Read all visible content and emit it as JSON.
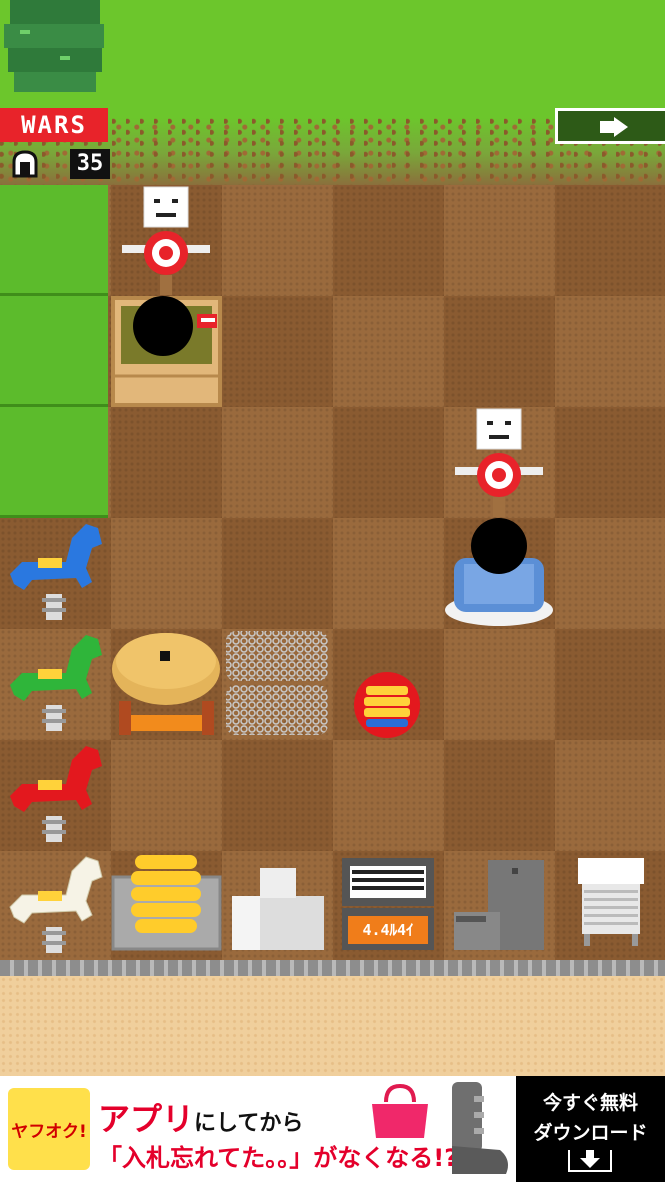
{
  "hud": {
    "mode_label": "WARS",
    "stone_count": "35"
  },
  "colors": {
    "grass": "#6cc62c",
    "dirt_light": "#9a6a3d",
    "dirt_dark": "#8a5b31",
    "badge_red": "#e8232a",
    "ad_red": "#e4002b"
  },
  "board": {
    "columns": 6,
    "rows": 7,
    "pieces": [
      {
        "name": "target-dummy",
        "row": 0,
        "col": 1
      },
      {
        "name": "crate-with-black-blob",
        "row": 1,
        "col": 1
      },
      {
        "name": "target-dummy",
        "row": 2,
        "col": 4
      },
      {
        "name": "seated-person-back",
        "row": 3,
        "col": 4
      },
      {
        "name": "blue-spring-horse",
        "row": 3,
        "col": 0
      },
      {
        "name": "green-spring-horse",
        "row": 4,
        "col": 0
      },
      {
        "name": "red-spring-horse",
        "row": 5,
        "col": 0
      },
      {
        "name": "white-spring-horse",
        "row": 6,
        "col": 0
      },
      {
        "name": "round-wooden-table",
        "row": 4,
        "col": 1
      },
      {
        "name": "chain-net",
        "row": 4,
        "col": 2
      },
      {
        "name": "coin-stack",
        "row": 4,
        "col": 3
      },
      {
        "name": "coin-stack-on-box",
        "row": 6,
        "col": 1
      },
      {
        "name": "white-stairs",
        "row": 6,
        "col": 2
      },
      {
        "name": "register-machine",
        "row": 6,
        "col": 3
      },
      {
        "name": "grey-desk",
        "row": 6,
        "col": 4
      },
      {
        "name": "white-shutter-stand",
        "row": 6,
        "col": 5
      }
    ]
  },
  "machine_display": "4.4ﾙ4ｲ",
  "ad": {
    "logo_text": "ヤフオク!",
    "line1_big": "アプリ",
    "line1_small": "にしてから",
    "line2": "「入札忘れてた。。」がなくなる!?",
    "cta_line1": "今すぐ無料",
    "cta_line2": "ダウンロード"
  }
}
